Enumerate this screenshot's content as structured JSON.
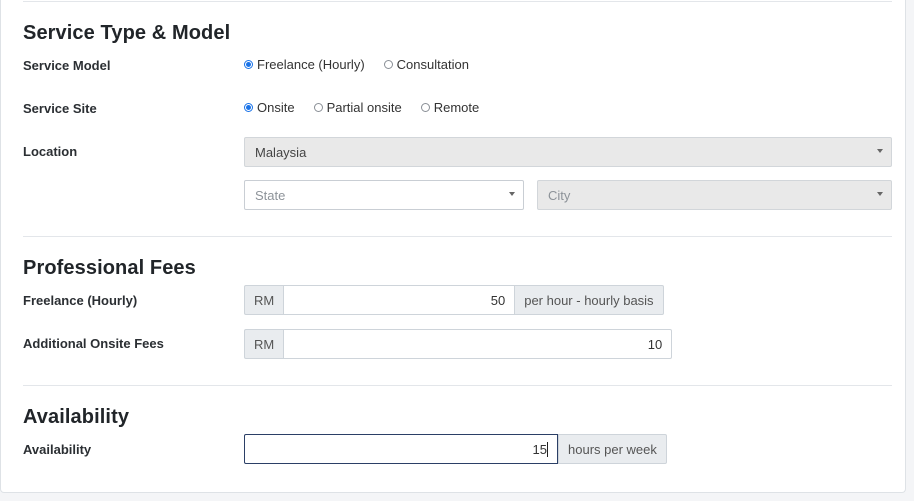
{
  "sections": {
    "service": {
      "title": "Service Type & Model",
      "service_model": {
        "label": "Service Model",
        "options": [
          {
            "label": "Freelance (Hourly)",
            "selected": true
          },
          {
            "label": "Consultation",
            "selected": false
          }
        ]
      },
      "service_site": {
        "label": "Service Site",
        "options": [
          {
            "label": "Onsite",
            "selected": true
          },
          {
            "label": "Partial onsite",
            "selected": false
          },
          {
            "label": "Remote",
            "selected": false
          }
        ]
      },
      "location": {
        "label": "Location",
        "country": "Malaysia",
        "state_placeholder": "State",
        "city_placeholder": "City"
      }
    },
    "fees": {
      "title": "Professional Fees",
      "freelance": {
        "label": "Freelance (Hourly)",
        "currency": "RM",
        "value": "50",
        "suffix": "per hour - hourly basis"
      },
      "onsite": {
        "label": "Additional Onsite Fees",
        "currency": "RM",
        "value": "10"
      }
    },
    "availability": {
      "title": "Availability",
      "label": "Availability",
      "value": "15",
      "suffix": "hours per week"
    }
  },
  "colors": {
    "accent": "#1a73e8",
    "focus_border": "#2b3f66",
    "addon_bg": "#e9ecef",
    "disabled_bg": "#e9e9e9"
  }
}
